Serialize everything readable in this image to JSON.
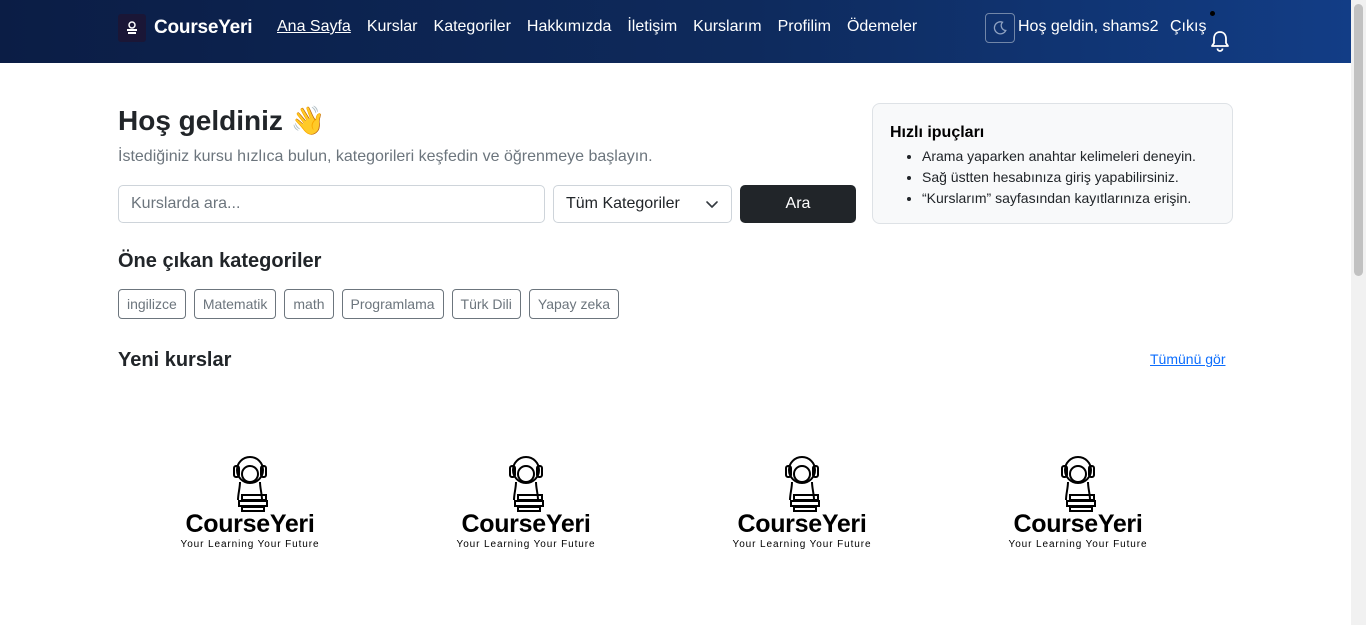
{
  "brand": {
    "name": "CourseYeri"
  },
  "nav": {
    "links": [
      {
        "label": "Ana Sayfa",
        "active": true
      },
      {
        "label": "Kurslar"
      },
      {
        "label": "Kategoriler"
      },
      {
        "label": "Hakkımızda"
      },
      {
        "label": "İletişim"
      },
      {
        "label": "Kurslarım"
      },
      {
        "label": "Profilim"
      },
      {
        "label": "Ödemeler"
      }
    ],
    "theme_toggle_icon": "moon-icon",
    "greeting": "Hoş geldin, shams2",
    "logout": "Çıkış",
    "notification_icon": "bell-icon"
  },
  "hero": {
    "title": "Hoş geldiniz 👋",
    "subtitle": "İstediğiniz kursu hızlıca bulun, kategorileri keşfedin ve öğrenmeye başlayın."
  },
  "search": {
    "placeholder": "Kurslarda ara...",
    "value": "",
    "category_selected": "Tüm Kategoriler",
    "button": "Ara"
  },
  "tips": {
    "title": "Hızlı ipuçları",
    "items": [
      "Arama yaparken anahtar kelimeleri deneyin.",
      "Sağ üstten hesabınıza giriş yapabilirsiniz.",
      "“Kurslarım” sayfasından kayıtlarınıza erişin."
    ]
  },
  "featured": {
    "title": "Öne çıkan kategoriler",
    "categories": [
      "ingilizce",
      "Matematik",
      "math",
      "Programlama",
      "Türk Dili",
      "Yapay zeka"
    ]
  },
  "new_courses": {
    "title": "Yeni kurslar",
    "see_all": "Tümünü gör",
    "cards": [
      {
        "wordmark": "CourseYeri",
        "tagline": "Your Learning Your Future"
      },
      {
        "wordmark": "CourseYeri",
        "tagline": "Your Learning Your Future"
      },
      {
        "wordmark": "CourseYeri",
        "tagline": "Your Learning Your Future"
      },
      {
        "wordmark": "CourseYeri",
        "tagline": "Your Learning Your Future"
      }
    ]
  },
  "colors": {
    "navbar_start": "#0b1d45",
    "navbar_end": "#123d86",
    "primary_button": "#212529",
    "link": "#0d6efd"
  }
}
